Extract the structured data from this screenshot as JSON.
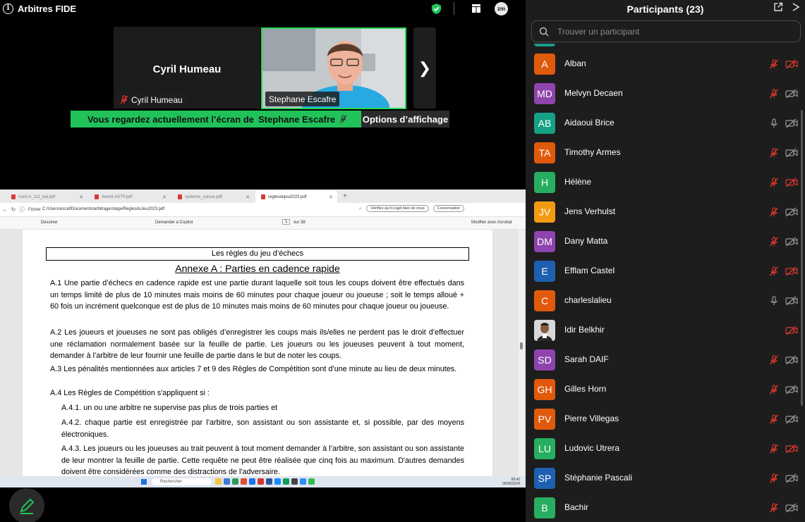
{
  "meeting": {
    "title": "Arbitres FIDE",
    "host_badge": "zm"
  },
  "tiles": {
    "cyril": {
      "display_name": "Cyril Humeau",
      "tag": "Cyril Humeau"
    },
    "stephane": {
      "tag": "Stephane Escafre"
    }
  },
  "share": {
    "banner_prefix": "Vous regardez actuellement l’écran de",
    "presenter": "Stephane Escafre",
    "view_options": "Options d’affichage"
  },
  "browser": {
    "tabs": [
      "nomi A_111_bal.pdf",
      "Avenir ASTP.pdf",
      "systeme_suisse.pdf",
      "reglesdujeu2023.pdf"
    ],
    "file_label": "Fichier",
    "url": "C:/Users/escaf/Documents/arbitrage/stage/ReglesduJeu2023.pdf",
    "verify_pill": "Vérifiez qu'il s'agit bien de vous",
    "conversation": "Conversation",
    "toolbar": {
      "draw": "Dessiner",
      "copilot": "Demander à Copilot",
      "page": "1",
      "page_total": "sur 38",
      "edit": "Modifier avec Acrobat"
    }
  },
  "document": {
    "header": "Les règles du jeu d’échecs",
    "title": "Annexe A : Parties en cadence rapide",
    "p1": "A.1 Une partie d’échecs en cadence rapide est une partie durant laquelle soit tous les coups doivent être effectués dans un temps limité de plus de 10 minutes mais moins de 60 minutes pour chaque joueur ou joueuse ; soit le temps alloué + 60 fois un incrément quelconque est de plus de 10 minutes mais moins de 60 minutes pour chaque joueur ou joueuse.",
    "p2": "A.2    Les joueurs et joueuses ne sont pas obligés d’enregistrer les coups mais ils/elles ne perdent pas le droit d’effectuer une réclamation normalement basée sur la feuille de partie. Les joueurs ou les joueuses peuvent à tout moment, demander à l’arbitre de leur fournir une feuille de partie dans le but de noter les coups.",
    "p3": "A.3 Les pénalités mentionnées aux articles 7 et 9 des Règles de Compétition sont d’une minute au lieu de deux minutes.",
    "p4": "A.4 Les Règles de Compétition s'appliquent si :",
    "p41": "A.4.1. un ou une arbitre ne supervise pas plus de trois parties et",
    "p42": "A.4.2. chaque partie est enregistrée par l’arbitre, son assistant ou son assistante et, si possible, par des moyens électroniques.",
    "p43": "A.4.3. Les joueurs ou les joueuses au trait peuvent à tout moment demander à l’arbitre, son assistant ou son assistante de leur montrer la feuille de partie. Cette requête ne peut être réalisée que cinq fois au maximum. D'autres demandes doivent être considérées comme des distractions de l'adversaire."
  },
  "taskbar": {
    "search": "Rechercher",
    "time": "08:42",
    "date": "05/06/2024"
  },
  "participants": {
    "title": "Participants (23)",
    "search_placeholder": "Trouver un participant",
    "list": [
      {
        "initials": "A",
        "name": "Alban",
        "color": "#e05a0c",
        "mic": "muted",
        "cam": "off-red"
      },
      {
        "initials": "MD",
        "name": "Melvyn Decaen",
        "color": "#8e44ad",
        "mic": "muted",
        "cam": "off"
      },
      {
        "initials": "AB",
        "name": "Aidaoui Brice",
        "color": "#16a085",
        "mic": "on",
        "cam": "off"
      },
      {
        "initials": "TA",
        "name": "Timothy Armes",
        "color": "#e05a0c",
        "mic": "muted",
        "cam": "off"
      },
      {
        "initials": "H",
        "name": "Hélène",
        "color": "#27ae60",
        "mic": "muted",
        "cam": "off-red"
      },
      {
        "initials": "JV",
        "name": "Jens Verhulst",
        "color": "#f39c12",
        "mic": "muted",
        "cam": "off"
      },
      {
        "initials": "DM",
        "name": "Dany Matta",
        "color": "#8e44ad",
        "mic": "muted",
        "cam": "off"
      },
      {
        "initials": "E",
        "name": "Efflam Castel",
        "color": "#1f5fb0",
        "mic": "muted",
        "cam": "off-red"
      },
      {
        "initials": "C",
        "name": "charleslalieu",
        "color": "#e05a0c",
        "mic": "on",
        "cam": "off"
      },
      {
        "initials": "",
        "name": "Idir Belkhir",
        "color": "#cfcfcf",
        "mic": "none",
        "cam": "off-red"
      },
      {
        "initials": "SD",
        "name": "Sarah DAIF",
        "color": "#8e44ad",
        "mic": "muted",
        "cam": "off"
      },
      {
        "initials": "GH",
        "name": "Gilles Horn",
        "color": "#e05a0c",
        "mic": "muted",
        "cam": "off"
      },
      {
        "initials": "PV",
        "name": "Pierre Villegas",
        "color": "#e05a0c",
        "mic": "muted",
        "cam": "off"
      },
      {
        "initials": "LU",
        "name": "Ludovic Utrera",
        "color": "#27ae60",
        "mic": "muted",
        "cam": "off-red"
      },
      {
        "initials": "SP",
        "name": "Stéphanie Pascali",
        "color": "#1f5fb0",
        "mic": "muted",
        "cam": "off"
      },
      {
        "initials": "B",
        "name": "Bachir",
        "color": "#27ae60",
        "mic": "muted",
        "cam": "off"
      }
    ]
  }
}
